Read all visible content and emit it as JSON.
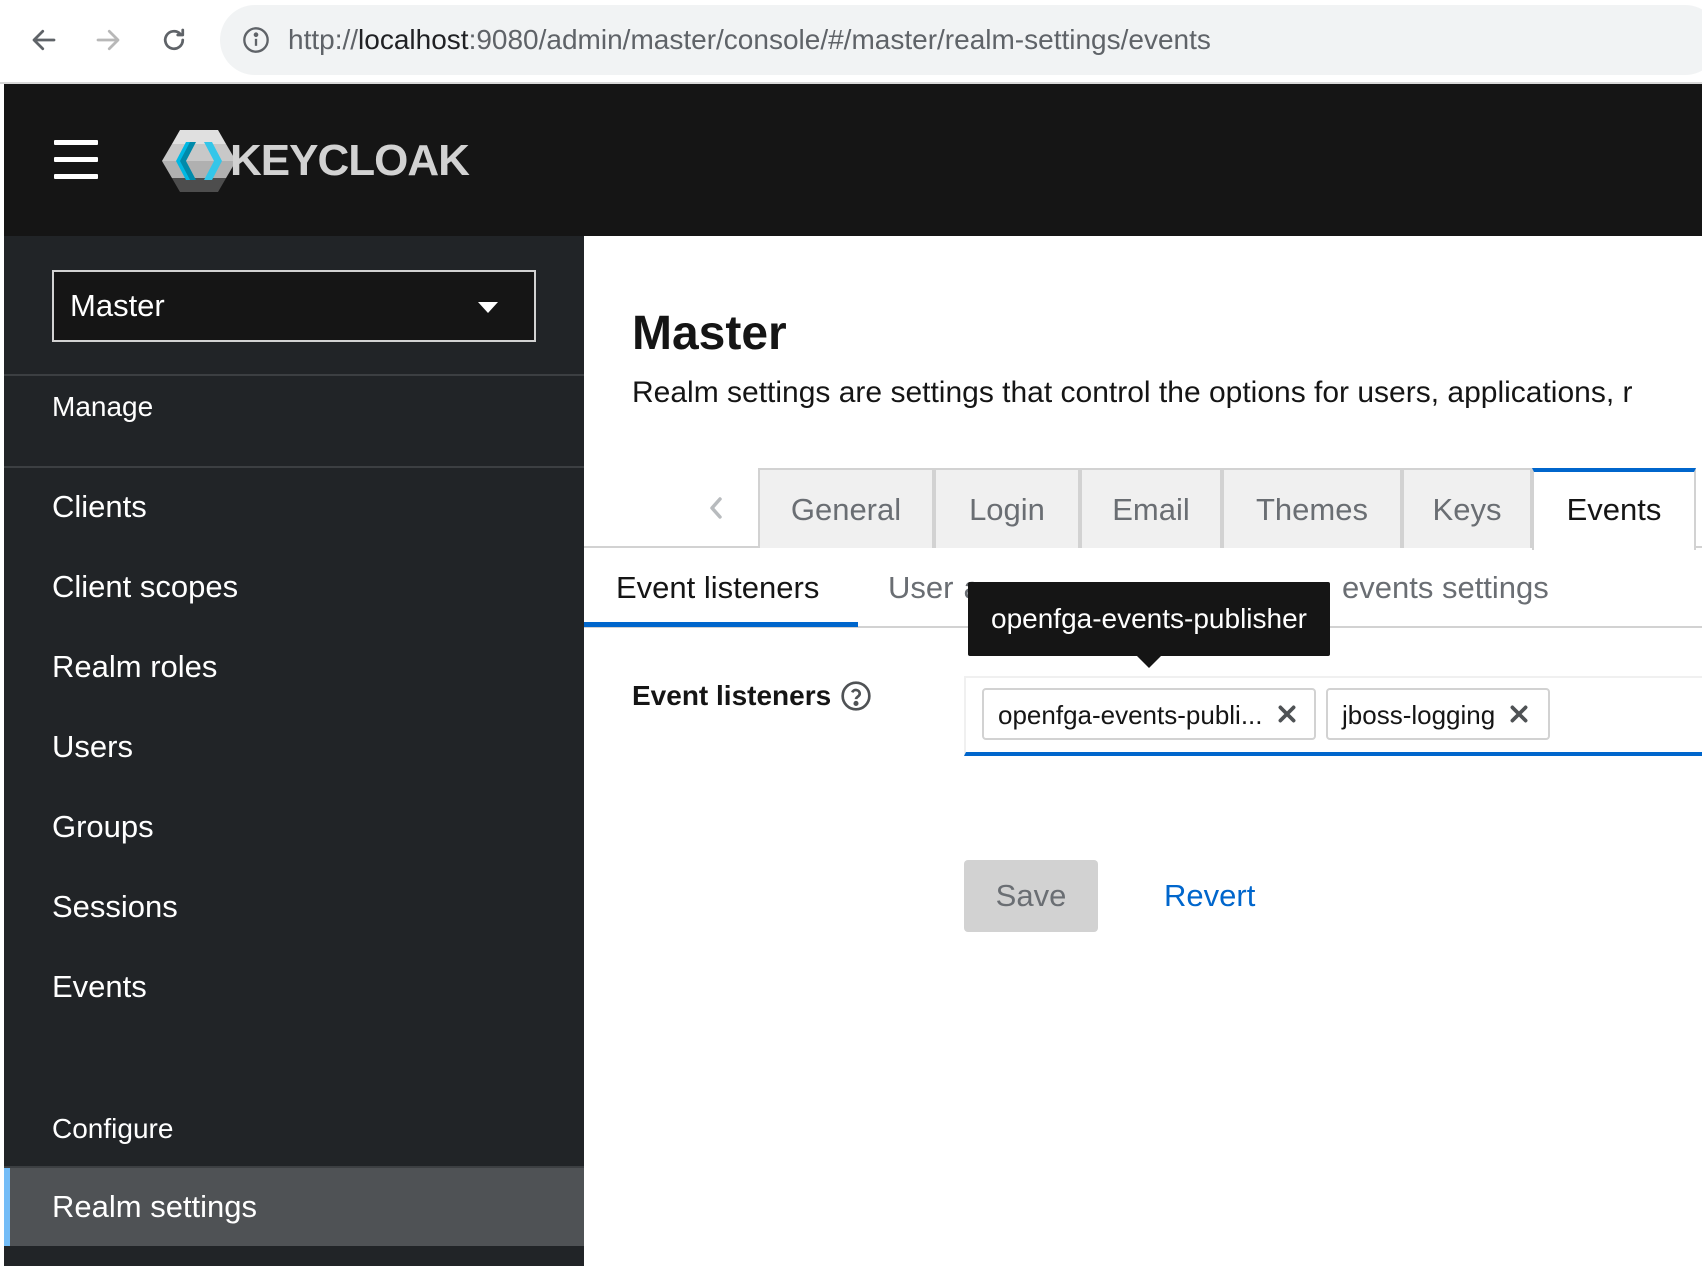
{
  "browser": {
    "url_prefix": "http://",
    "url_host": "localhost",
    "url_rest": ":9080/admin/master/console/#/master/realm-settings/events"
  },
  "masthead": {
    "logo_text": "KEYCLOAK",
    "icons": {
      "menu": "hamburger-icon",
      "logo": "keycloak-logo-icon"
    }
  },
  "sidebar": {
    "realm_selector": "Master",
    "sections": [
      {
        "label": "Manage",
        "items": [
          "Clients",
          "Client scopes",
          "Realm roles",
          "Users",
          "Groups",
          "Sessions",
          "Events"
        ]
      },
      {
        "label": "Configure",
        "items": [
          "Realm settings"
        ]
      }
    ],
    "active_item": "Realm settings"
  },
  "main": {
    "title": "Master",
    "description": "Realm settings are settings that control the options for users, applications, r",
    "tabs": [
      "General",
      "Login",
      "Email",
      "Themes",
      "Keys",
      "Events"
    ],
    "active_tab": "Events",
    "subtabs": [
      "Event listeners",
      "User events settings",
      "Admin events settings"
    ],
    "active_subtab": "Event listeners",
    "visible_subtab_fragments": [
      "User",
      "a",
      "events settings"
    ],
    "tooltip": "openfga-events-publisher",
    "field": {
      "label": "Event listeners",
      "chips": [
        "openfga-events-publi...",
        "jboss-logging"
      ]
    },
    "actions": {
      "save": "Save",
      "revert": "Revert"
    }
  },
  "colors": {
    "masthead": "#151515",
    "sidebar": "#212427",
    "sidebar_active": "#4f5255",
    "sidebar_active_accent": "#73bcf7",
    "primary": "#0066cc"
  }
}
